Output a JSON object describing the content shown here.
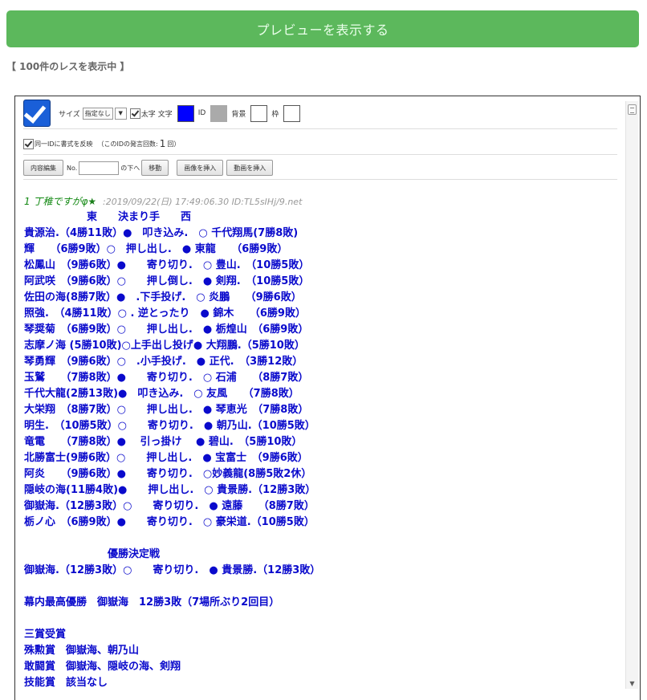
{
  "preview_button": "プレビューを表示する",
  "count_text": "【 100件のレスを表示中 】",
  "toolbar": {
    "size_label": "サイズ",
    "size_value": "指定なし",
    "bold_label": "太字",
    "char_label": "文字",
    "id_label": "ID",
    "bg_label": "背景",
    "border_label": "枠",
    "colors": {
      "char": "#0000ff",
      "id": "#aaaaaa",
      "bg": "#ffffff",
      "border": "#ffffff"
    },
    "same_id_label": "同一IDに書式を反映",
    "post_count_prefix": "（このIDの発言回数:",
    "post_count_value": "1",
    "post_count_suffix": "回）",
    "edit_button": "内容編集",
    "no_label": "No.",
    "below_label": "の下へ",
    "move_button": "移動",
    "insert_image_button": "画像を挿入",
    "insert_video_button": "動画を挿入"
  },
  "post": {
    "number": "1",
    "name": "丁稚ですがφ",
    "star": "★",
    "meta": ":2019/09/22(日) 17:49:06.30 ID:TL5sIHj/9.net",
    "lines": [
      "　　　　　　東　　決まり手　　西",
      "貴源治.（4勝11敗）●　叩き込み.　○ 千代翔馬(7勝8敗)",
      "輝　　（6勝9敗）○　押し出し.　● 東龍　　（6勝9敗）",
      "松鳳山　（9勝6敗）●　　寄り切り.　○ 豊山.　（10勝5敗）",
      "阿武咲　（9勝6敗）○　　押し倒し.　● 剣翔.　（10勝5敗）",
      "佐田の海(8勝7敗）●　.下手投げ.　○ 炎鵬　　（9勝6敗）",
      "照強.　（4勝11敗）○ . 逆とったり　● 錦木　　（6勝9敗）",
      "琴奨菊　（6勝9敗）○　　押し出し.　● 栃煌山　（6勝9敗）",
      "志摩ノ海 (5勝10敗)○上手出し投げ● 大翔鵬.（5勝10敗）",
      "琴勇輝　（9勝6敗）○　.小手投げ.　● 正代.　（3勝12敗）",
      "玉鷲　　（7勝8敗）●　　寄り切り.　○ 石浦　　（8勝7敗）",
      "千代大龍(2勝13敗)●　叩き込み.　○ 友風　　（7勝8敗）",
      "大栄翔　（8勝7敗）○　　押し出し.　● 琴恵光　（7勝8敗）",
      "明生.　（10勝5敗）○　　寄り切り.　● 朝乃山.（10勝5敗）",
      "竜電　　（7勝8敗）●　 引っ掛け　 ● 碧山.　（5勝10敗）",
      "北勝富士(9勝6敗）○　　押し出し.　● 宝富士　（9勝6敗）",
      "阿炎　　（9勝6敗）●　　寄り切り.　○妙義龍(8勝5敗2休）",
      "隠岐の海(11勝4敗)●　　押し出し.　○ 貴景勝.（12勝3敗）",
      "御嶽海.（12勝3敗）○　　寄り切り.　● 遠藤　　（8勝7敗）",
      "栃ノ心　（6勝9敗）●　　寄り切り.　○ 豪栄道.（10勝5敗）",
      "",
      "　　　　　　　　優勝決定戦",
      "御嶽海.（12勝3敗）○　　寄り切り.　● 貴景勝.（12勝3敗）",
      "",
      "幕内最高優勝　御嶽海　12勝3敗（7場所ぶり2回目）",
      "",
      "三賞受賞",
      "殊勲賞　御嶽海、朝乃山",
      "敢闘賞　御嶽海、隠岐の海、剣翔",
      "技能賞　該当なし"
    ]
  }
}
